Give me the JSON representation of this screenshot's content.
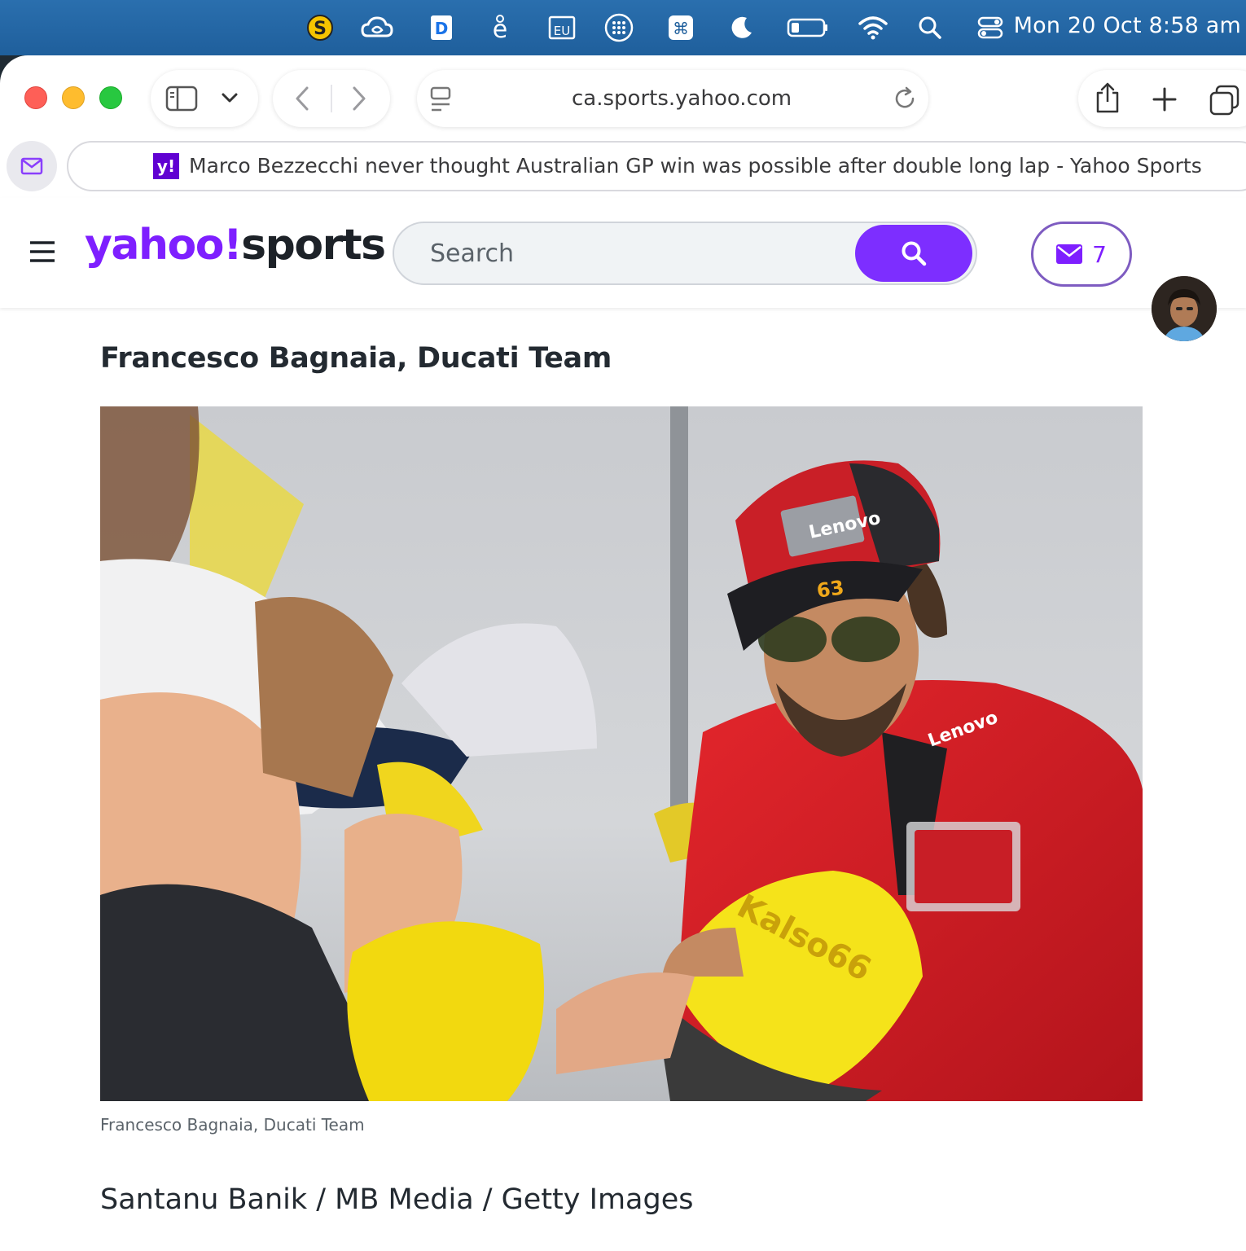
{
  "menubar": {
    "clock": "Mon 20 Oct  8:58 am",
    "icons": [
      "scrooge-s-icon",
      "creative-cloud-icon",
      "dash-d-icon",
      "edge-e-icon",
      "eu-icon",
      "dots-grid-icon",
      "command-key-icon",
      "moon-icon",
      "battery-icon",
      "wifi-icon",
      "spotlight-search-icon",
      "control-center-icon"
    ]
  },
  "browser": {
    "address": "ca.sports.yahoo.com",
    "tab_title": "Marco Bezzecchi never thought Australian GP win was possible after double long lap - Yahoo Sports",
    "favicon_text": "y!"
  },
  "yahoo_header": {
    "logo_yahoo": "yahoo!",
    "logo_sports": "sports",
    "search_placeholder": "Search",
    "mail_count": "7",
    "brand_color": "#7e1fff"
  },
  "article": {
    "heading": "Francesco Bagnaia, Ducati Team",
    "caption": "Francesco Bagnaia, Ducati Team",
    "credit": "Santanu Banik / MB Media / Getty Images",
    "photo_text": {
      "cap_brand": "Lenovo",
      "cap_number": "63",
      "jacket_brand": "Lenovo",
      "kid_cap_text": "Kalso66"
    }
  }
}
